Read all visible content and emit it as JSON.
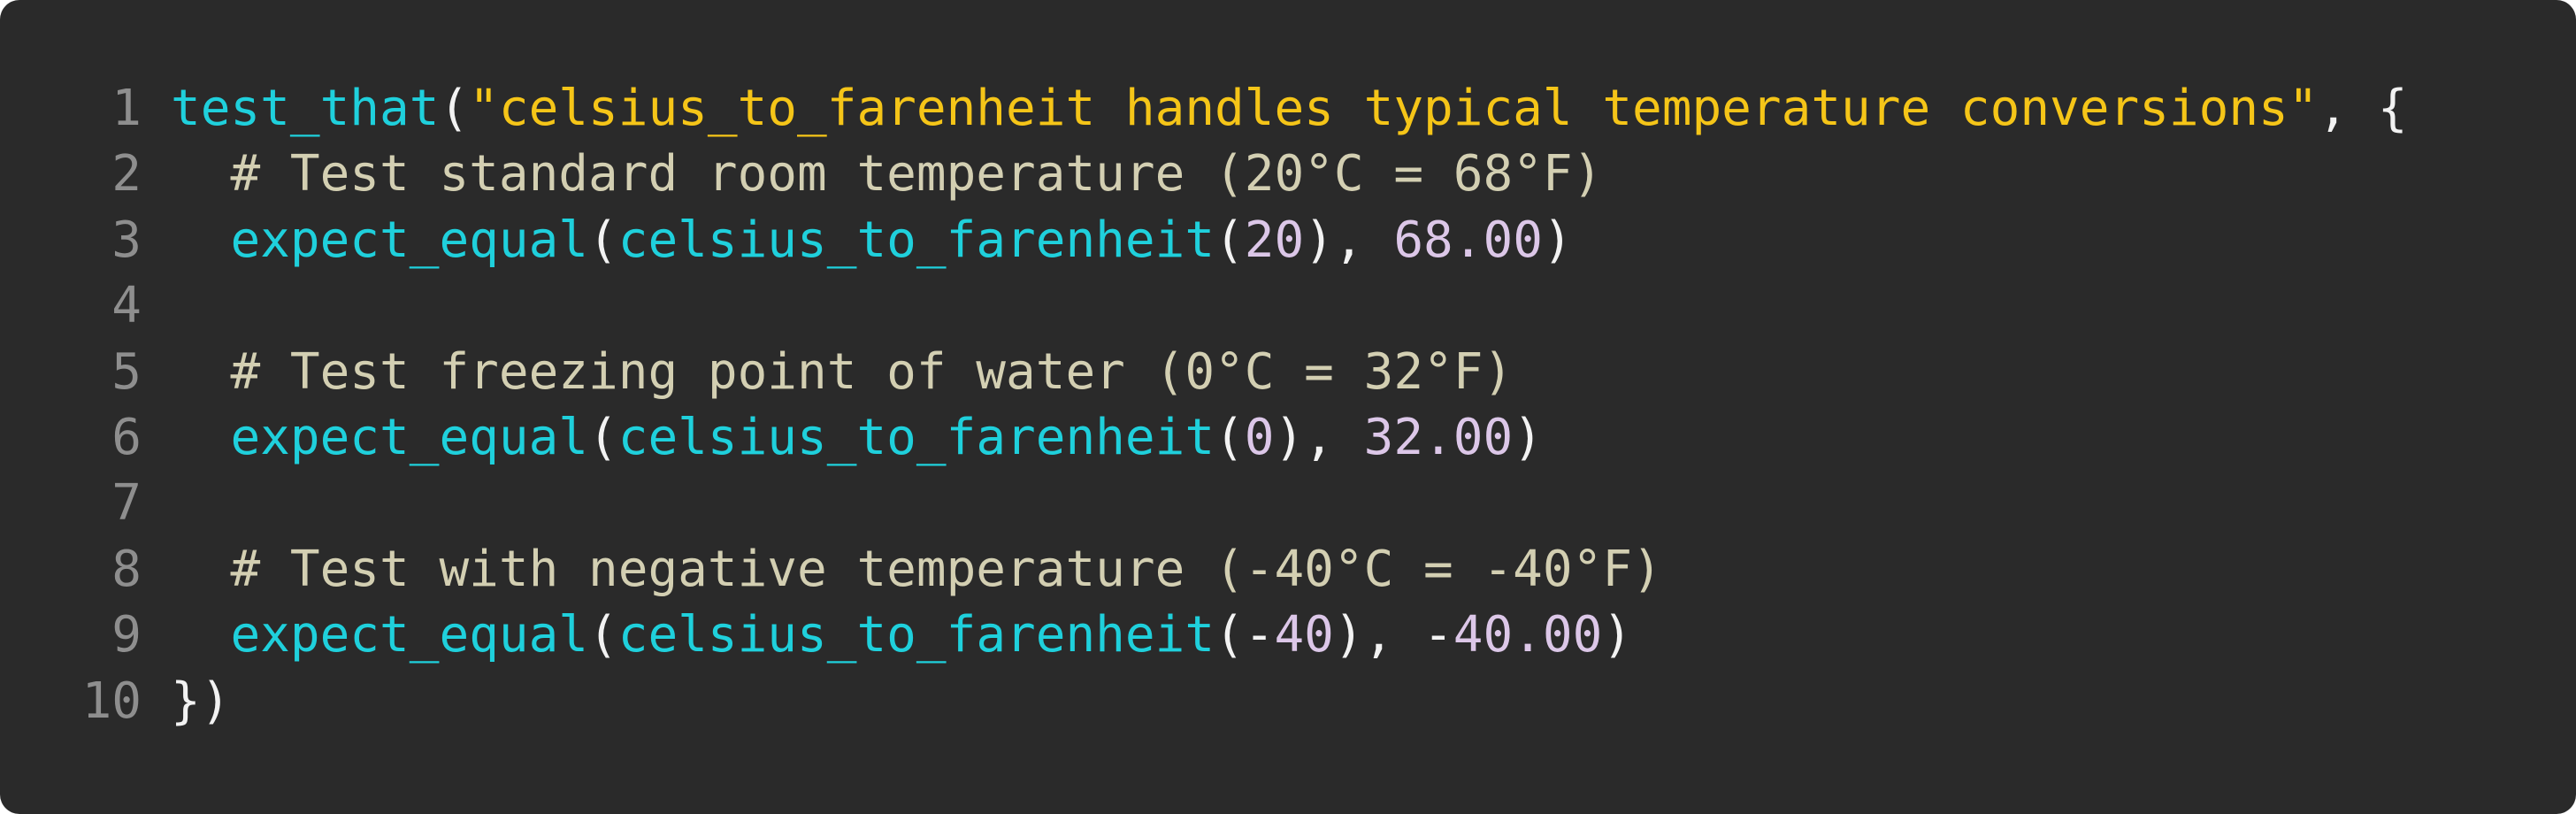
{
  "code_block": {
    "lines": [
      {
        "number": "1",
        "tokens": [
          {
            "type": "fn",
            "text": "test_that"
          },
          {
            "type": "punc",
            "text": "("
          },
          {
            "type": "str",
            "text": "\"celsius_to_farenheit handles typical temperature conversions\""
          },
          {
            "type": "punc",
            "text": ", {"
          }
        ]
      },
      {
        "number": "2",
        "tokens": [
          {
            "type": "punc",
            "text": "  "
          },
          {
            "type": "comment",
            "text": "# Test standard room temperature (20°C = 68°F)"
          }
        ]
      },
      {
        "number": "3",
        "tokens": [
          {
            "type": "punc",
            "text": "  "
          },
          {
            "type": "fn",
            "text": "expect_equal"
          },
          {
            "type": "punc",
            "text": "("
          },
          {
            "type": "fn",
            "text": "celsius_to_farenheit"
          },
          {
            "type": "punc",
            "text": "("
          },
          {
            "type": "num",
            "text": "20"
          },
          {
            "type": "punc",
            "text": "), "
          },
          {
            "type": "num",
            "text": "68.00"
          },
          {
            "type": "punc",
            "text": ")"
          }
        ]
      },
      {
        "number": "4",
        "tokens": []
      },
      {
        "number": "5",
        "tokens": [
          {
            "type": "punc",
            "text": "  "
          },
          {
            "type": "comment",
            "text": "# Test freezing point of water (0°C = 32°F)"
          }
        ]
      },
      {
        "number": "6",
        "tokens": [
          {
            "type": "punc",
            "text": "  "
          },
          {
            "type": "fn",
            "text": "expect_equal"
          },
          {
            "type": "punc",
            "text": "("
          },
          {
            "type": "fn",
            "text": "celsius_to_farenheit"
          },
          {
            "type": "punc",
            "text": "("
          },
          {
            "type": "num",
            "text": "0"
          },
          {
            "type": "punc",
            "text": "), "
          },
          {
            "type": "num",
            "text": "32.00"
          },
          {
            "type": "punc",
            "text": ")"
          }
        ]
      },
      {
        "number": "7",
        "tokens": []
      },
      {
        "number": "8",
        "tokens": [
          {
            "type": "punc",
            "text": "  "
          },
          {
            "type": "comment",
            "text": "# Test with negative temperature (-40°C = -40°F)"
          }
        ]
      },
      {
        "number": "9",
        "tokens": [
          {
            "type": "punc",
            "text": "  "
          },
          {
            "type": "fn",
            "text": "expect_equal"
          },
          {
            "type": "punc",
            "text": "("
          },
          {
            "type": "fn",
            "text": "celsius_to_farenheit"
          },
          {
            "type": "punc",
            "text": "(-"
          },
          {
            "type": "num",
            "text": "40"
          },
          {
            "type": "punc",
            "text": "), -"
          },
          {
            "type": "num",
            "text": "40.00"
          },
          {
            "type": "punc",
            "text": ")"
          }
        ]
      },
      {
        "number": "10",
        "tokens": [
          {
            "type": "punc",
            "text": "})"
          }
        ]
      }
    ]
  },
  "colors": {
    "background": "#2a2a2a",
    "line_number": "#8e8e8e",
    "function": "#1fd0dc",
    "string": "#f5c518",
    "comment": "#d3cfb2",
    "number": "#dcc7e8",
    "punctuation": "#f2f2f2"
  }
}
